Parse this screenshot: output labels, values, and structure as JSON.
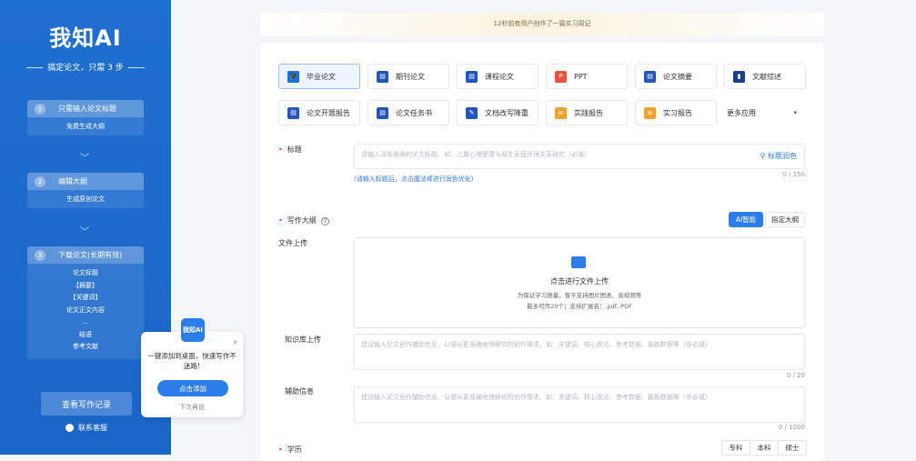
{
  "sidebar": {
    "logo": "我知AI",
    "slogan": "搞定论文，只需 3 步",
    "steps": [
      {
        "num": "1",
        "title": "只需输入论文标题",
        "sub": "免费生成大纲"
      },
      {
        "num": "2",
        "title": "编辑大纲",
        "sub": "生成原创论文"
      },
      {
        "num": "3",
        "title": "下载论文(长期有效)",
        "items": [
          "论文标题",
          "【摘要】",
          "【关键词】",
          "论文正文内容",
          "...",
          "结语",
          "参考文献"
        ]
      }
    ],
    "chevron": "﹀",
    "history_button": "查看写作记录",
    "service": "联系客服"
  },
  "popup": {
    "logo": "我知AI",
    "close": "×",
    "text": "一键添加到桌面，快速写作不迷路!",
    "button": "点击添加",
    "later": "下次再说"
  },
  "notice": "12秒前有用户创作了一篇实习周记",
  "types": [
    {
      "label": "毕业论文",
      "icon": "graduation-cap-icon",
      "color": "#1e6fd9",
      "glyph": "🎓"
    },
    {
      "label": "期刊论文",
      "icon": "journal-icon",
      "color": "#2456b8",
      "glyph": "▤"
    },
    {
      "label": "课程论文",
      "icon": "course-icon",
      "color": "#2456b8",
      "glyph": "▤"
    },
    {
      "label": "PPT",
      "icon": "ppt-icon",
      "color": "#e8553e",
      "glyph": "P"
    },
    {
      "label": "论文摘要",
      "icon": "abstract-icon",
      "color": "#2456b8",
      "glyph": "▤"
    },
    {
      "label": "文献综述",
      "icon": "literature-icon",
      "color": "#1c3f8c",
      "glyph": "▮"
    },
    {
      "label": "论文开题报告",
      "icon": "proposal-icon",
      "color": "#2456b8",
      "glyph": "▤"
    },
    {
      "label": "论文任务书",
      "icon": "task-book-icon",
      "color": "#2456b8",
      "glyph": "▤"
    },
    {
      "label": "文档改写降重",
      "icon": "rewrite-icon",
      "color": "#2456b8",
      "glyph": "✎"
    },
    {
      "label": "实践报告",
      "icon": "practice-report-icon",
      "color": "#f0a030",
      "glyph": "≡"
    },
    {
      "label": "实习报告",
      "icon": "internship-report-icon",
      "color": "#f0a030",
      "glyph": "≡"
    },
    {
      "label": "更多应用",
      "icon": "",
      "color": "",
      "glyph": ""
    }
  ],
  "more_chevron": "▾",
  "title_field": {
    "label": "标题",
    "placeholder": "请输入清晰准确的论文标题。如：儿童心理健康与原生家庭环境关系研究（必填）",
    "polish": "标题润色",
    "counter": "0 / 150",
    "hint": "(请输入标题后，点击魔法棒进行润色优化)"
  },
  "outline": {
    "label": "写作大纲",
    "help": "?",
    "ai": "AI智能",
    "custom": "指定大纲"
  },
  "upload": {
    "label": "文件上传",
    "title": "点击进行文件上传",
    "note1": "为保证学习质量，暂不支持图片图表、音视频等",
    "note2": "最多可传20个；支持扩展名：.pdf,.PDF"
  },
  "knowledge": {
    "label": "知识库上传",
    "placeholder": "建议输入论文创作辅助信息，以便AI更准确地理解你的创作需求。如：关键词、核心观点、参考数据、最新数据等（非必填）",
    "counter": "0 / 20"
  },
  "aux": {
    "label": "辅助信息",
    "placeholder": "建议输入论文创作辅助信息，以便AI更准确地理解你的创作需求。如：关键词、核心观点、参考数据、最新数据等（非必填）",
    "counter": "0 / 1000"
  },
  "degree": {
    "label": "学历",
    "options": [
      "专科",
      "本科",
      "硕士"
    ]
  }
}
